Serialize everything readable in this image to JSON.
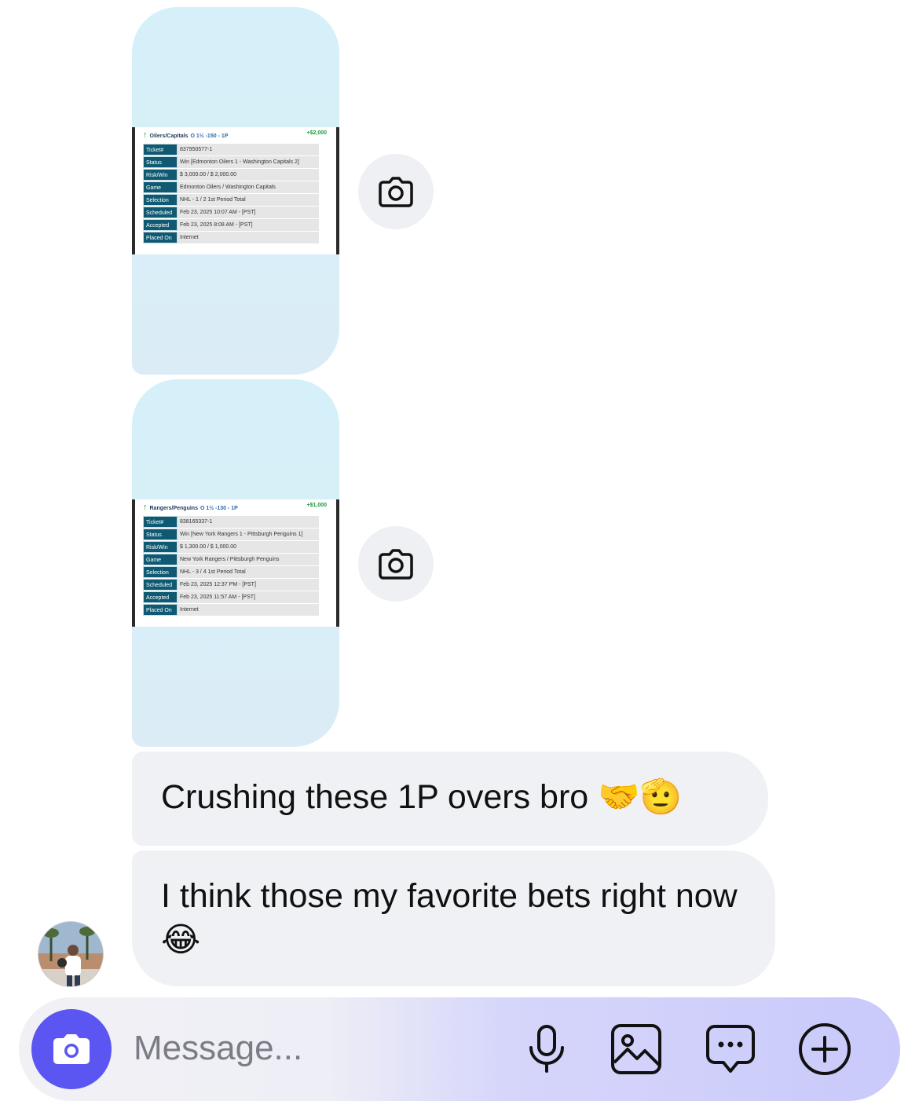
{
  "messages": {
    "images": [
      {
        "ticket": {
          "teams": "Oilers/Capitals",
          "line": "O 1½ -150 - 1P",
          "amount": "+$2,000",
          "rows": [
            {
              "k": "Ticket#",
              "v": "837950577-1"
            },
            {
              "k": "Status",
              "v": "Win [Edmonton Oilers 1 - Washington Capitals 2]"
            },
            {
              "k": "Risk/Win",
              "v": "$ 3,000.00 / $ 2,000.00"
            },
            {
              "k": "Game",
              "v": "Edmonton Oilers / Washington Capitals"
            },
            {
              "k": "Selection",
              "v": "NHL - 1 / 2 1st Period Total"
            },
            {
              "k": "Scheduled",
              "v": "Feb 23, 2025 10:07 AM - [PST]"
            },
            {
              "k": "Accepted",
              "v": "Feb 23, 2025 8:08 AM - [PST]"
            },
            {
              "k": "Placed On",
              "v": "Internet"
            }
          ]
        }
      },
      {
        "ticket": {
          "teams": "Rangers/Penguins",
          "line": "O 1½ -130 - 1P",
          "amount": "+$1,000",
          "rows": [
            {
              "k": "Ticket#",
              "v": "838165337-1"
            },
            {
              "k": "Status",
              "v": "Win [New York Rangers 1 - Pittsburgh Penguins 1]"
            },
            {
              "k": "Risk/Win",
              "v": "$ 1,300.00 / $ 1,000.00"
            },
            {
              "k": "Game",
              "v": "New York Rangers / Pittsburgh Penguins"
            },
            {
              "k": "Selection",
              "v": "NHL - 3 / 4 1st Period Total"
            },
            {
              "k": "Scheduled",
              "v": "Feb 23, 2025 12:37 PM - [PST]"
            },
            {
              "k": "Accepted",
              "v": "Feb 23, 2025 11:57 AM - [PST]"
            },
            {
              "k": "Placed On",
              "v": "Internet"
            }
          ]
        }
      }
    ],
    "text": [
      "Crushing these 1P overs bro 🤝🫡",
      "I think those my favorite bets right now 😂"
    ]
  },
  "composer": {
    "placeholder": "Message..."
  },
  "icons": {
    "photo_reply": "camera-icon",
    "composer_camera": "camera-icon",
    "mic": "microphone-icon",
    "gallery": "image-icon",
    "chat": "chat-bubble-icon",
    "plus": "plus-circle-icon"
  },
  "colors": {
    "composer_camera": "#5b55f2",
    "bubble_received": "#f0f1f4",
    "image_bubble": "#d5f0f9"
  }
}
